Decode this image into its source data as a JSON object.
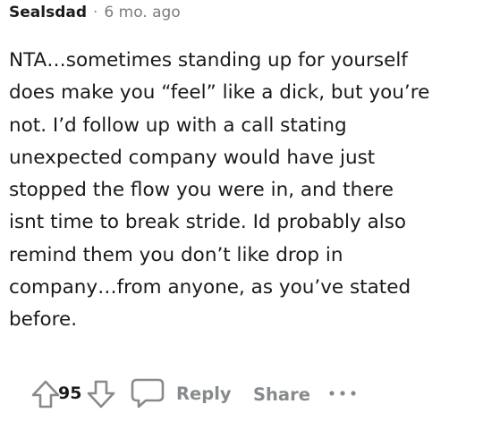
{
  "comment": {
    "author": "Sealsdad",
    "separator": "·",
    "time": "6 mo. ago",
    "body_lines": [
      "NTA…sometimes standing up for yourself",
      "does make you “feel” like a dick, but you’re",
      "not. I’d follow up with a call stating",
      "unexpected company would have just",
      "stopped the flow you were in, and there",
      "isnt time to break stride. Id probably also",
      "remind them you don’t like drop in",
      "company…from anyone, as you’ve stated",
      "before."
    ]
  },
  "actions": {
    "score": "95",
    "reply_label": "Reply",
    "share_label": "Share",
    "upvote_icon": "arrow-up-outline-icon",
    "downvote_icon": "arrow-down-outline-icon",
    "reply_icon": "speech-bubble-icon",
    "more_icon": "more-horizontal-icon"
  },
  "colors": {
    "text": "#1a1a1b",
    "muted": "#878a8c",
    "icon": "#878a8c",
    "background": "#ffffff"
  }
}
